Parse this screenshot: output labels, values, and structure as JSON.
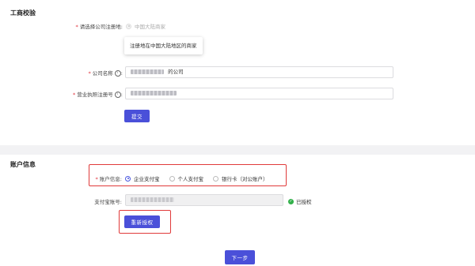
{
  "section_business": {
    "title": "工商校验",
    "region_label": "请选择公司注册地",
    "region_option": "中国大陆商家",
    "tooltip": "注册地在中国大陆地区的商家",
    "company_name_label": "公司名称",
    "company_name_value": "的公司",
    "license_label": "营业执照注册号",
    "submit_label": "提交"
  },
  "section_account": {
    "title": "账户信息",
    "account_label": "账户信息",
    "options": [
      "企业支付宝",
      "个人支付宝",
      "银行卡（对公账户）"
    ],
    "selected_index": 0,
    "alipay_label": "支付宝账号",
    "authorized_text": "已授权",
    "reauth_label": "重新授权"
  },
  "footer": {
    "next_label": "下一步"
  },
  "colors": {
    "accent": "#4a50d9",
    "required": "#e0303a",
    "highlight": "#e03a3a",
    "success": "#32b04a"
  }
}
